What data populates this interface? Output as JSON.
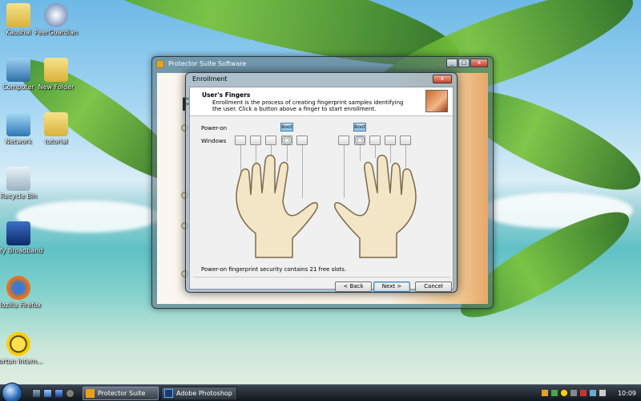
{
  "desktop": {
    "icons": [
      {
        "label": "Kaushal",
        "icon": "folder-icon"
      },
      {
        "label": "PeerGuardian",
        "icon": "peerguardian-icon"
      },
      {
        "label": "Computer",
        "icon": "computer-icon"
      },
      {
        "label": "New Folder",
        "icon": "folder-icon"
      },
      {
        "label": "Network",
        "icon": "network-icon"
      },
      {
        "label": "tutorial",
        "icon": "folder-icon"
      },
      {
        "label": "Recycle Bin",
        "icon": "recycle-bin-icon"
      },
      {
        "label": "Sify Broadband",
        "icon": "sify-icon"
      },
      {
        "label": "Mozilla Firefox",
        "icon": "firefox-icon"
      },
      {
        "label": "Norton Intern...",
        "icon": "norton-icon"
      }
    ]
  },
  "main_window": {
    "title": "Protector Suite Software",
    "heading_letter": "F"
  },
  "dialog": {
    "title": "Enrollment",
    "close_label": "x",
    "header_title": "User's Fingers",
    "header_desc": "Enrollment is the process of creating fingerprint samples identifying the user. Click a button above a finger to start enrollment.",
    "row_power_on": "Power-on",
    "row_windows": "Windows",
    "boot_label": "Boot",
    "status_text": "Power-on fingerprint security contains 21 free slots.",
    "back_label": "< Back",
    "next_label": "Next >",
    "cancel_label": "Cancel"
  },
  "taskbar": {
    "tasks": [
      {
        "label": "Protector Suite Soft...",
        "icon": "protector-icon",
        "active": true
      },
      {
        "label": "Adobe Photoshop",
        "icon": "photoshop-icon",
        "active": false
      }
    ],
    "clock": "10:09"
  },
  "colors": {
    "accent": "#3c7fb1",
    "close_red": "#c24a36"
  }
}
